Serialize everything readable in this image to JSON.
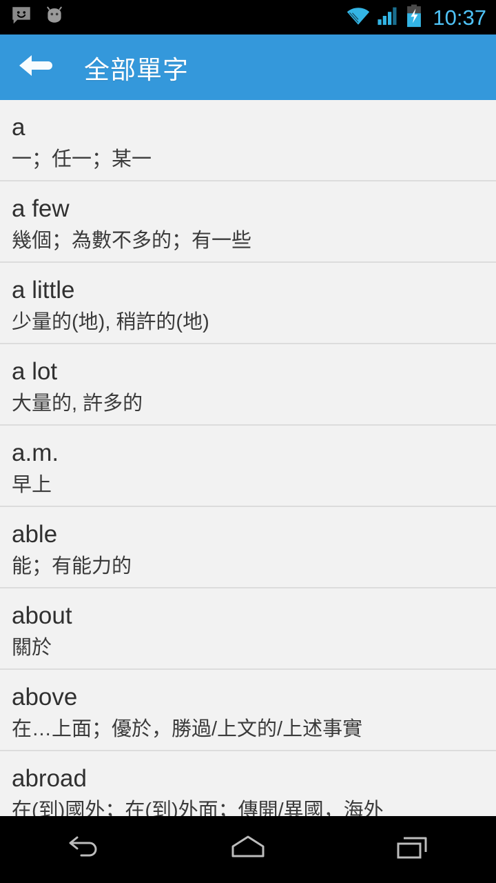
{
  "status_bar": {
    "icons": [
      "messaging-icon",
      "android-head-icon",
      "wifi-icon",
      "signal-icon",
      "battery-charging-icon"
    ],
    "time": "10:37",
    "time_color": "#4fc3f7",
    "background": "#000000"
  },
  "action_bar": {
    "title": "全部單字",
    "back_icon": "arrow-left-icon",
    "background": "#3498db",
    "text_color": "#ffffff"
  },
  "list": {
    "items": [
      {
        "word": "a",
        "definition": "一；任一；某一"
      },
      {
        "word": "a few",
        "definition": "幾個；為數不多的；有一些"
      },
      {
        "word": "a little",
        "definition": "少量的(地), 稍許的(地)"
      },
      {
        "word": "a lot",
        "definition": "大量的, 許多的"
      },
      {
        "word": "a.m.",
        "definition": "早上"
      },
      {
        "word": "able",
        "definition": "能；有能力的"
      },
      {
        "word": "about",
        "definition": "關於"
      },
      {
        "word": "above",
        "definition": "在…上面；優於，勝過/上文的/上述事實"
      },
      {
        "word": "abroad",
        "definition": "在(到)國外；在(到)外面；傳開/異國，海外"
      }
    ],
    "background": "#f2f2f2",
    "divider_color": "#dcdcdc",
    "word_color": "#303030",
    "definition_color": "#3a3a3a"
  },
  "nav_bar": {
    "buttons": [
      {
        "name": "back",
        "icon": "nav-back-icon"
      },
      {
        "name": "home",
        "icon": "nav-home-icon"
      },
      {
        "name": "recents",
        "icon": "nav-recents-icon"
      }
    ],
    "background": "#000000",
    "icon_color": "#bdbdbd"
  }
}
